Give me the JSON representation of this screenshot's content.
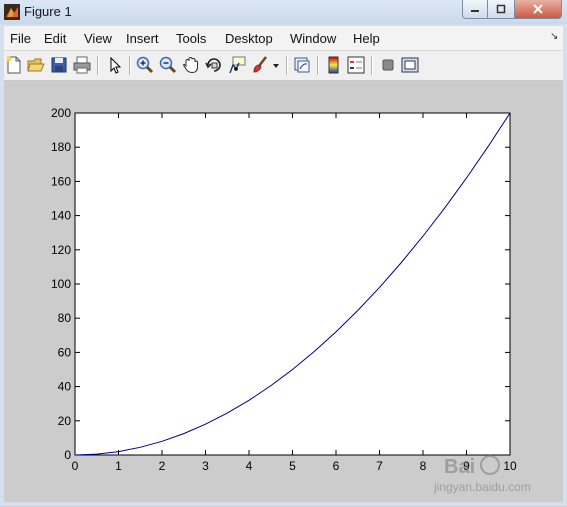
{
  "window": {
    "title": "Figure 1"
  },
  "menu": [
    "File",
    "Edit",
    "View",
    "Insert",
    "Tools",
    "Desktop",
    "Window",
    "Help"
  ],
  "toolbar": {
    "icons": [
      "new-figure-icon",
      "open-file-icon",
      "save-icon",
      "print-icon",
      "select-arrow-icon",
      "zoom-in-icon",
      "zoom-out-icon",
      "pan-hand-icon",
      "rotate-3d-icon",
      "data-cursor-icon",
      "brush-icon",
      "brush-dropdown-icon",
      "link-plot-icon",
      "colorbar-icon",
      "legend-icon",
      "hide-plot-tools-icon",
      "show-plot-tools-icon"
    ]
  },
  "watermark": {
    "main": "Bai",
    "sub": "jingyan.baidu.com"
  },
  "chart_data": {
    "type": "line",
    "title": "",
    "xlabel": "",
    "ylabel": "",
    "xlim": [
      0,
      10
    ],
    "ylim": [
      0,
      200
    ],
    "xticks": [
      0,
      1,
      2,
      3,
      4,
      5,
      6,
      7,
      8,
      9,
      10
    ],
    "yticks": [
      0,
      20,
      40,
      60,
      80,
      100,
      120,
      140,
      160,
      180,
      200
    ],
    "series": [
      {
        "color": "#00008b",
        "x": [
          0,
          0.5,
          1,
          1.5,
          2,
          2.5,
          3,
          3.5,
          4,
          4.5,
          5,
          5.5,
          6,
          6.5,
          7,
          7.5,
          8,
          8.5,
          9,
          9.5,
          10
        ],
        "y": [
          0,
          0.5,
          2,
          4.5,
          8,
          12.5,
          18,
          24.5,
          32,
          40.5,
          50,
          60.5,
          72,
          84.5,
          98,
          112.5,
          128,
          144.5,
          162,
          180.5,
          200
        ]
      }
    ],
    "grid": false,
    "legend": "none"
  }
}
